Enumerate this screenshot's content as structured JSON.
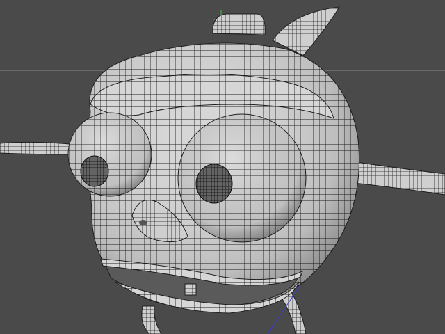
{
  "viewport": {
    "shading": "wireframe-on-shaded",
    "background_color": "#4a4a4a",
    "wire_color": "#1c1c1c",
    "surface_color": "#d9d9d9",
    "horizon_line_color": "#8a8a8a",
    "axis_y_color": "#3fbf3f",
    "axis_z_color": "#3a3ad8"
  },
  "scene": {
    "model": "cartoon-character-head",
    "parts": [
      "head",
      "left-eye",
      "right-eye",
      "left-pupil",
      "right-pupil",
      "nose",
      "mouth",
      "tooth",
      "left-antenna",
      "right-antenna",
      "top-fin",
      "hair-tuft",
      "legs"
    ]
  }
}
